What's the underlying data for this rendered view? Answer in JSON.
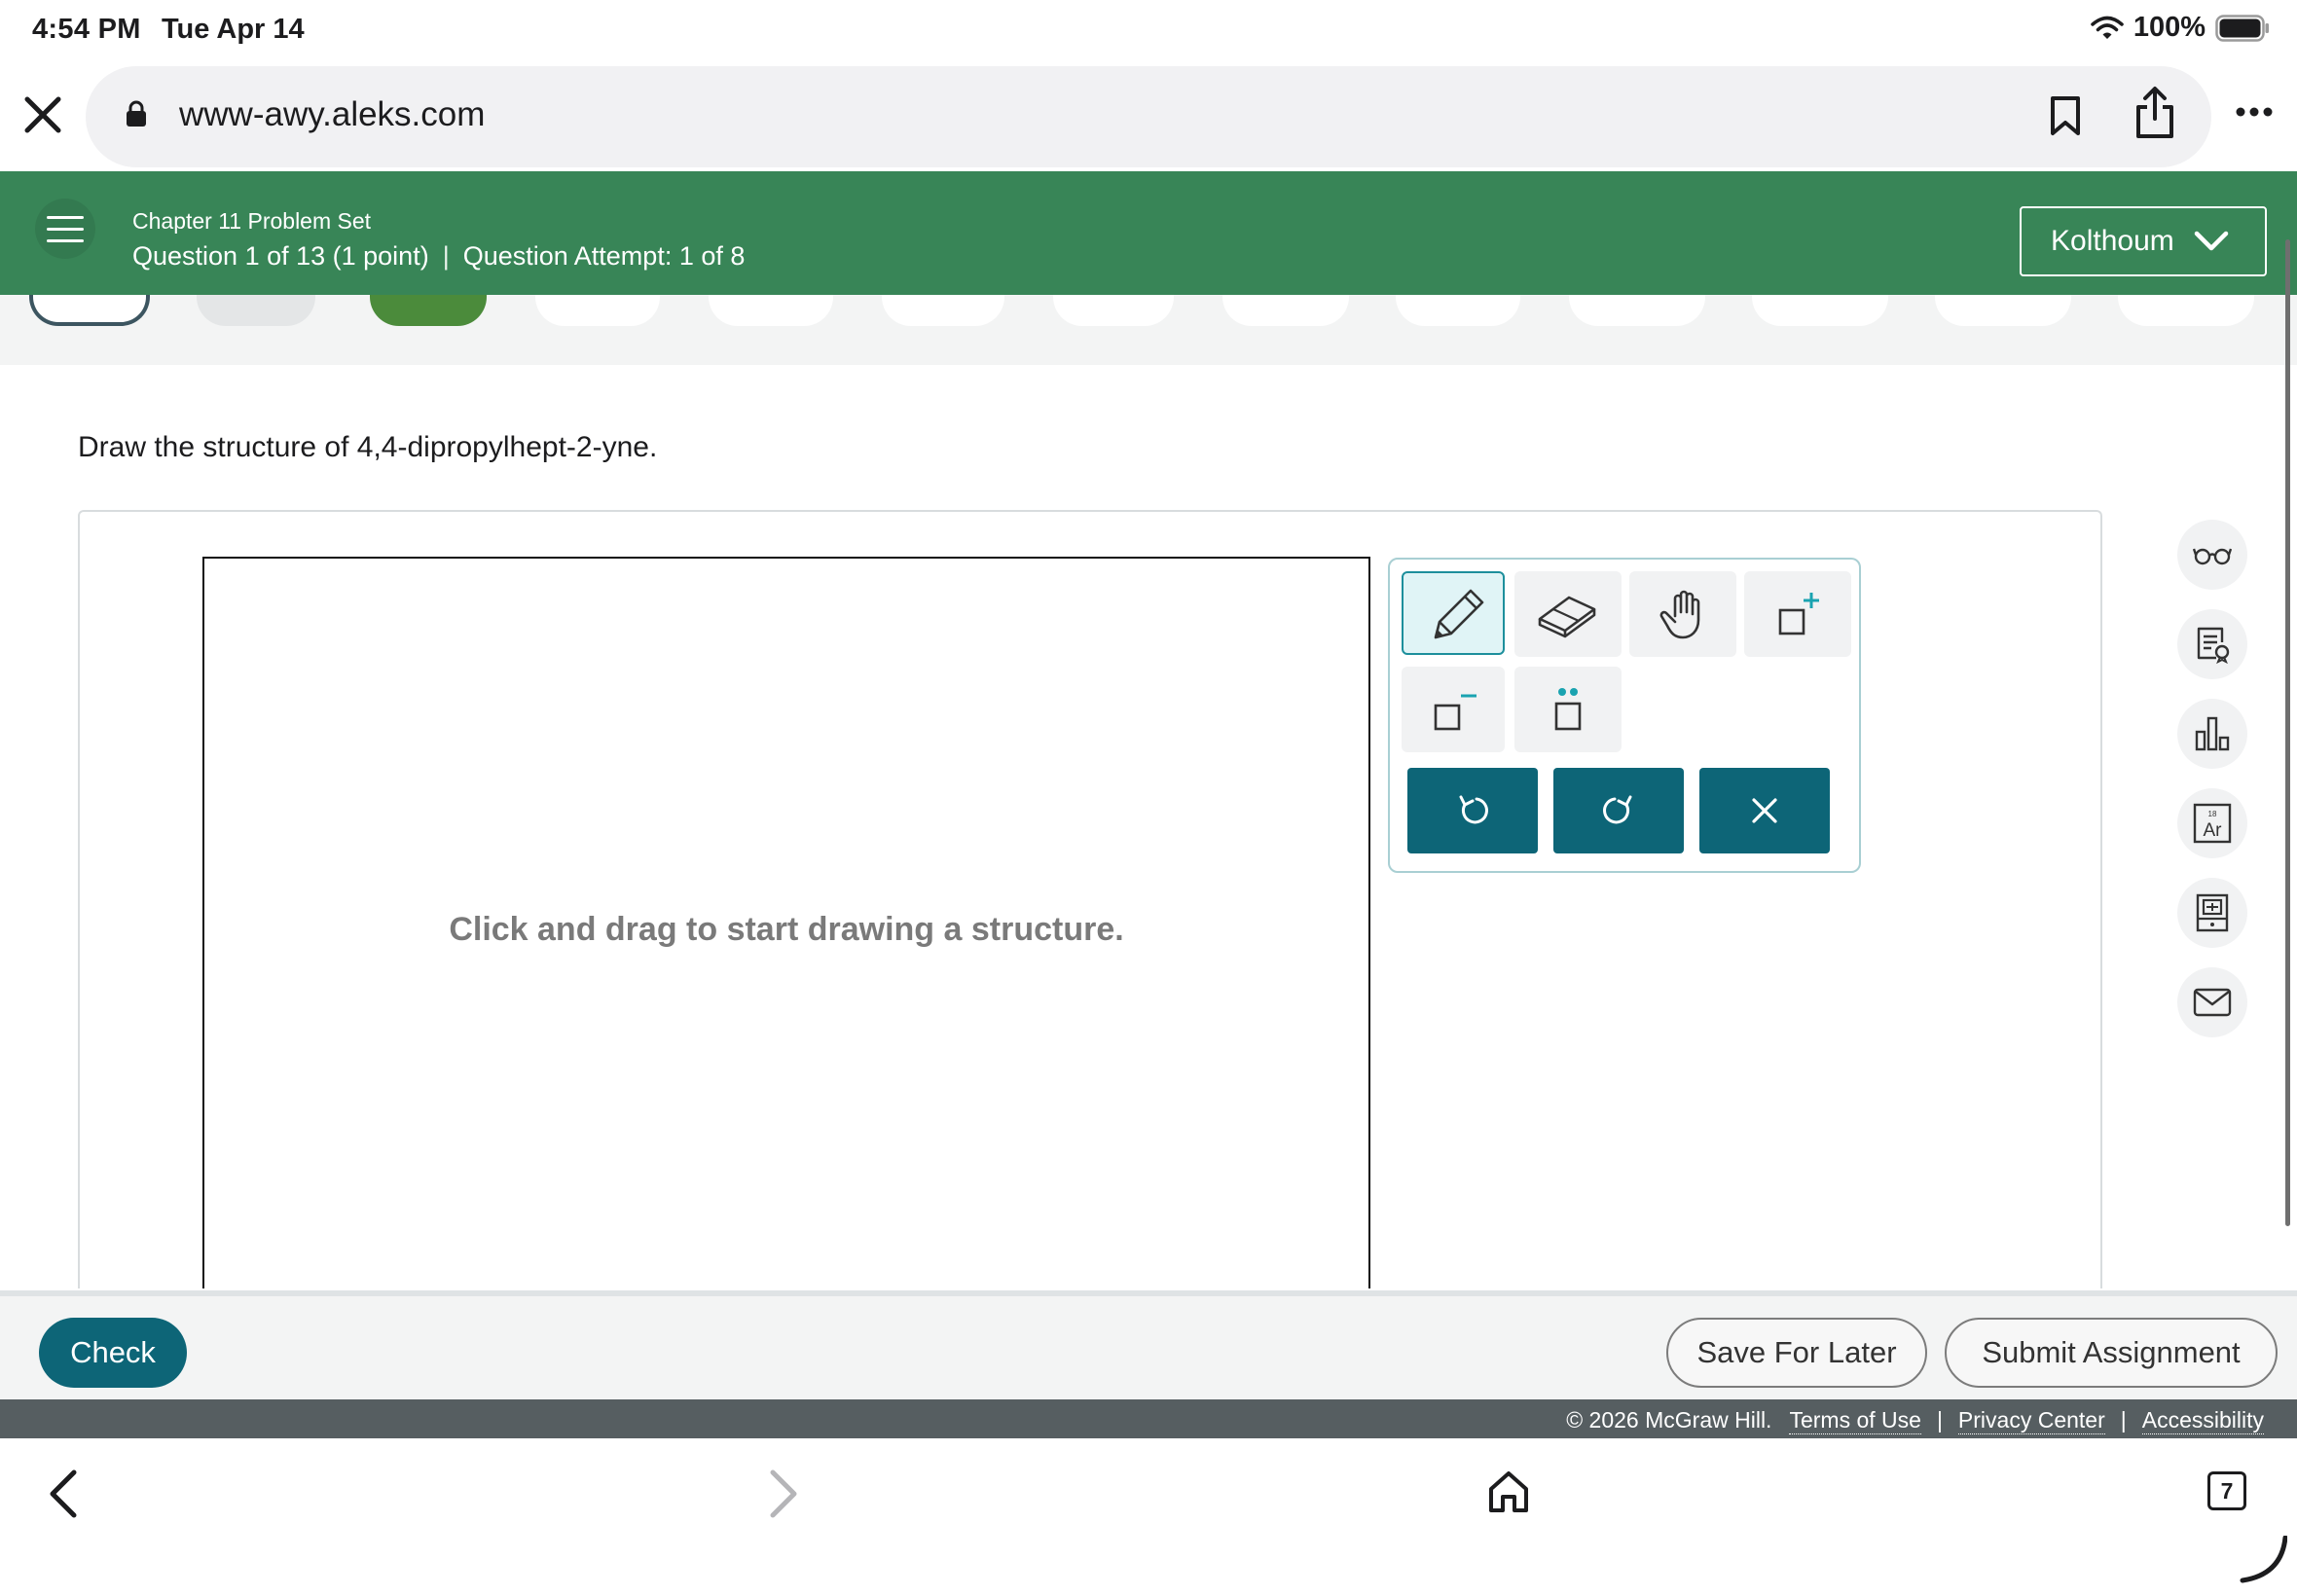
{
  "status_bar": {
    "time": "4:54 PM",
    "date": "Tue Apr 14",
    "battery": "100%"
  },
  "browser": {
    "url": "www-awy.aleks.com",
    "close_icon": "close-icon",
    "bookmark_icon": "bookmark-icon",
    "share_icon": "share-icon",
    "more_icon": "ellipsis-icon"
  },
  "header": {
    "set_title": "Chapter 11 Problem Set",
    "question_label": "Question 1 of 13 (1 point)",
    "separator": "|",
    "attempt_label": "Question Attempt: 1 of 8",
    "user_name": "Kolthoum",
    "accent_color": "#388557"
  },
  "question": {
    "prompt": "Draw the structure of 4,4-dipropylhept-2-yne."
  },
  "canvas": {
    "hint": "Click and drag to start drawing a structure."
  },
  "toolbox": {
    "tools": [
      "pencil-icon",
      "eraser-icon",
      "hand-icon",
      "positive-charge-icon",
      "negative-charge-icon",
      "lone-pair-icon"
    ],
    "actions": [
      "undo-icon",
      "redo-icon",
      "clear-icon"
    ],
    "action_color": "#0d6577"
  },
  "side_rail": {
    "items": [
      "glasses-icon",
      "notes-icon",
      "data-chart-icon",
      "periodic-table-icon",
      "calculator-icon",
      "mail-icon"
    ],
    "periodic_number": "18",
    "periodic_symbol": "Ar"
  },
  "actions": {
    "check": "Check",
    "save": "Save For Later",
    "submit": "Submit Assignment"
  },
  "footer": {
    "copyright": "© 2026 McGraw Hill.",
    "terms": "Terms of Use",
    "privacy": "Privacy Center",
    "accessibility": "Accessibility",
    "separator": "|"
  },
  "safari_toolbar": {
    "tab_count": "7"
  }
}
